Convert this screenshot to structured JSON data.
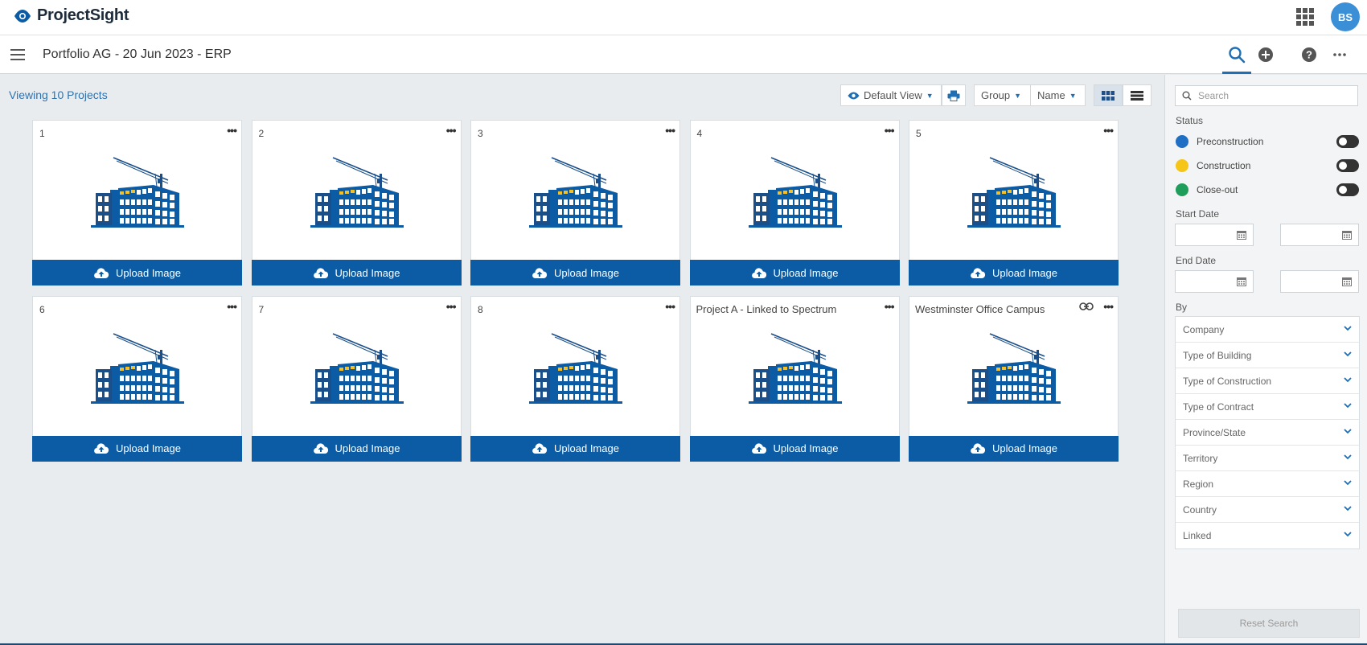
{
  "app": {
    "name": "ProjectSight",
    "user_initials": "BS"
  },
  "header": {
    "title": "Portfolio AG - 20 Jun 2023 - ERP"
  },
  "toolbar": {
    "viewing_text": "Viewing 10 Projects",
    "view_label": "Default View",
    "group_label": "Group",
    "sort_label": "Name"
  },
  "cards": [
    {
      "title": "1",
      "upload_label": "Upload Image"
    },
    {
      "title": "2",
      "upload_label": "Upload Image"
    },
    {
      "title": "3",
      "upload_label": "Upload Image"
    },
    {
      "title": "4",
      "upload_label": "Upload Image"
    },
    {
      "title": "5",
      "upload_label": "Upload Image"
    },
    {
      "title": "6",
      "upload_label": "Upload Image"
    },
    {
      "title": "7",
      "upload_label": "Upload Image"
    },
    {
      "title": "8",
      "upload_label": "Upload Image"
    },
    {
      "title": "Project A - Linked to Spectrum",
      "upload_label": "Upload Image"
    },
    {
      "title": "Westminster Office Campus",
      "upload_label": "Upload Image",
      "linked": true
    }
  ],
  "panel": {
    "search_placeholder": "Search",
    "status_label": "Status",
    "statuses": [
      {
        "label": "Preconstruction",
        "color": "#1f6fc5"
      },
      {
        "label": "Construction",
        "color": "#f5c518"
      },
      {
        "label": "Close-out",
        "color": "#1e9e5a"
      }
    ],
    "start_date_label": "Start Date",
    "end_date_label": "End Date",
    "by_label": "By",
    "by_filters": [
      "Company",
      "Type of Building",
      "Type of Construction",
      "Type of Contract",
      "Province/State",
      "Territory",
      "Region",
      "Country",
      "Linked"
    ],
    "reset_label": "Reset Search"
  },
  "colors": {
    "brand_blue": "#0b5ca4",
    "accent": "#1f6fb5"
  }
}
